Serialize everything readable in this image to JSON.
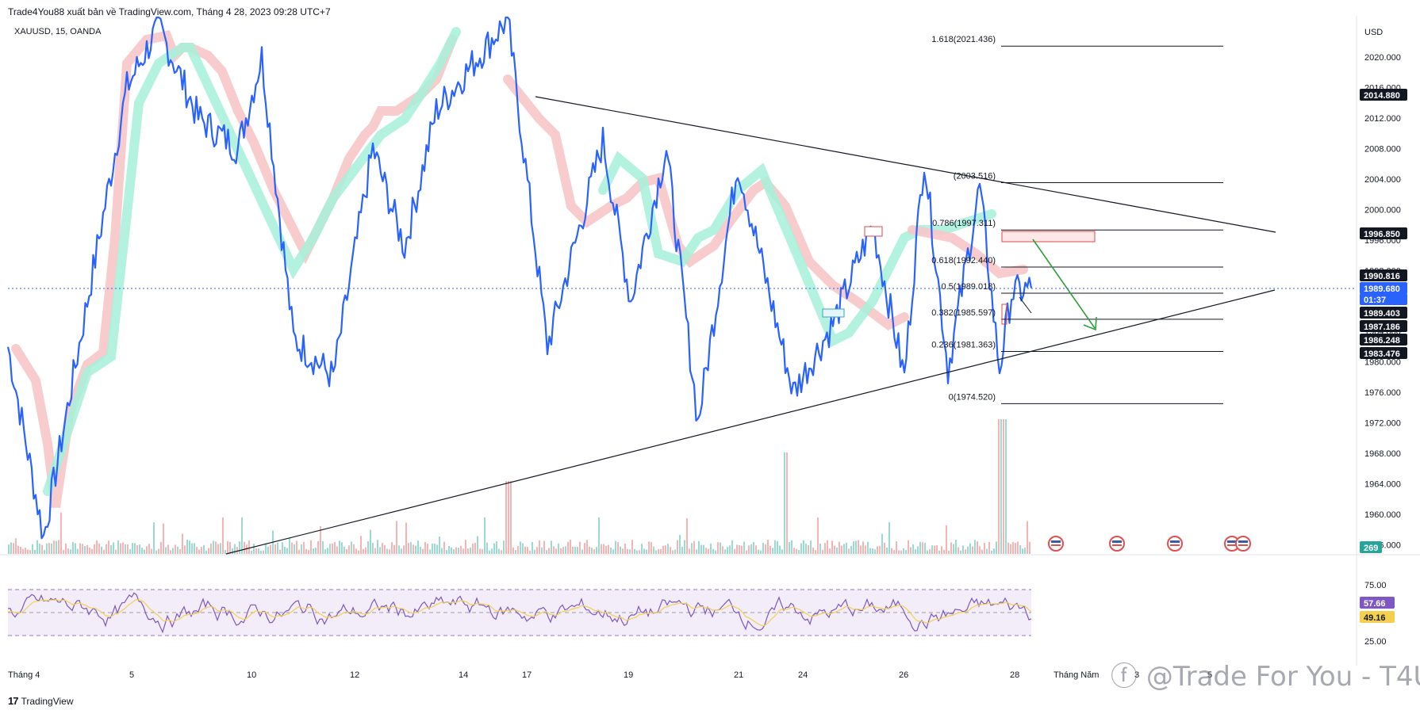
{
  "header": {
    "publish_line": "Trade4You88 xuất bản về TradingView.com, Tháng 4 28, 2023 09:28 UTC+7",
    "symbol_line": "XAUUSD, 15, OANDA"
  },
  "axis": {
    "currency": "USD",
    "price_ticks": [
      "2020.000",
      "2016.000",
      "2012.000",
      "2008.000",
      "2004.000",
      "2000.000",
      "1996.000",
      "1992.000",
      "1988.000",
      "1984.000",
      "1980.000",
      "1976.000",
      "1972.000",
      "1968.000",
      "1964.000",
      "1960.000",
      "1956.000"
    ],
    "rsi_ticks": [
      "75.00",
      "25.00"
    ],
    "time_ticks": [
      "Tháng 4",
      "5",
      "10",
      "12",
      "14",
      "17",
      "19",
      "21",
      "24",
      "26",
      "28",
      "Tháng Năm",
      "3",
      "5"
    ]
  },
  "price_labels": [
    {
      "text": "2014.880",
      "style": "dark"
    },
    {
      "text": "1996.850",
      "style": "dark"
    },
    {
      "text": "1990.816",
      "style": "dark"
    },
    {
      "text": "1989.680",
      "style": "blue"
    },
    {
      "text": "01:37",
      "style": "blue"
    },
    {
      "text": "1989.403",
      "style": "dark"
    },
    {
      "text": "1987.186",
      "style": "dark"
    },
    {
      "text": "1986.248",
      "style": "dark"
    },
    {
      "text": "1983.476",
      "style": "dark"
    },
    {
      "text": "269",
      "style": "teal"
    }
  ],
  "rsi_labels": [
    {
      "text": "57.66",
      "style": "purple"
    },
    {
      "text": "49.16",
      "style": "yellow"
    }
  ],
  "fib_levels": [
    {
      "label": "1.618(2021.436)",
      "price": 2021.436
    },
    {
      "label": "(2003.516)",
      "price": 2003.516
    },
    {
      "label": "0.786(1997.311)",
      "price": 1997.311
    },
    {
      "label": "0.618(1992.440)",
      "price": 1992.44
    },
    {
      "label": "0.5(1989.018)",
      "price": 1989.018
    },
    {
      "label": "0.382(1985.597)",
      "price": 1985.597
    },
    {
      "label": "0.236(1981.363)",
      "price": 1981.363
    },
    {
      "label": "0(1974.520)",
      "price": 1974.52
    }
  ],
  "chart_data": {
    "type": "line",
    "title": "XAUUSD, 15, OANDA",
    "ylabel": "USD",
    "ylim": [
      1956,
      2024
    ],
    "current_price": 1989.68,
    "x": [
      "Tháng 4",
      "5",
      "10",
      "12",
      "14",
      "17",
      "19",
      "21",
      "24",
      "26",
      "28"
    ],
    "series": [
      {
        "values": [
          1982,
          1958,
          2016,
          2024,
          1995,
          2013,
          2025,
          1982,
          2009,
          1988,
          2008,
          1972,
          2008,
          1975,
          1985,
          1998,
          1978,
          2007,
          1980,
          1989
        ]
      }
    ],
    "trendlines": [
      {
        "from": [
          1,
          2014.8
        ],
        "to": [
          29,
          1996.8
        ]
      },
      {
        "from": [
          9,
          1956
        ],
        "to": [
          29,
          1989.4
        ]
      }
    ],
    "rsi": {
      "ylim": [
        0,
        100
      ],
      "bands": [
        70,
        50,
        30
      ],
      "last": 57.66,
      "signal_last": 49.16
    }
  },
  "watermark": {
    "text": "@Trade For You - T4U"
  },
  "footer": {
    "brand": "TradingView"
  },
  "colors": {
    "price_line": "#2962ff",
    "up_band": "#a6f0d8",
    "down_band": "#f7c6c8",
    "rsi_line": "#7e57c2",
    "rsi_signal": "#f5d04f",
    "arrow": "#2e9e3e"
  }
}
